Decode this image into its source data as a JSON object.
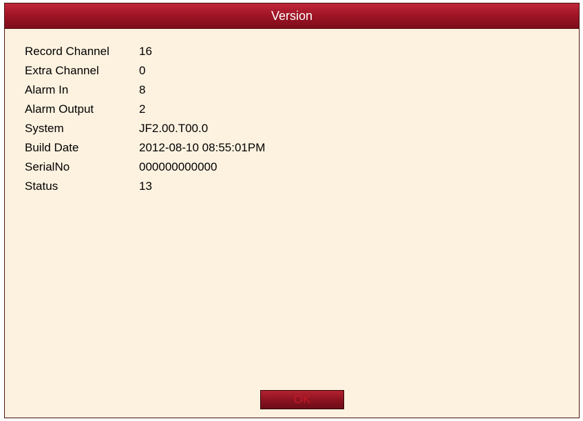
{
  "dialog": {
    "title": "Version",
    "ok_label": "OK"
  },
  "info": [
    {
      "label": "Record Channel",
      "value": "16"
    },
    {
      "label": "Extra Channel",
      "value": "0"
    },
    {
      "label": "Alarm In",
      "value": "8"
    },
    {
      "label": "Alarm Output",
      "value": "2"
    },
    {
      "label": "System",
      "value": "JF2.00.T00.0"
    },
    {
      "label": "Build Date",
      "value": "2012-08-10 08:55:01PM"
    },
    {
      "label": "SerialNo",
      "value": "000000000000"
    },
    {
      "label": "Status",
      "value": "13"
    }
  ],
  "colors": {
    "titlebar": "#9e1425",
    "body_background": "#fdf2e0",
    "button_background": "#8a1220",
    "button_text": "#c01a26"
  }
}
